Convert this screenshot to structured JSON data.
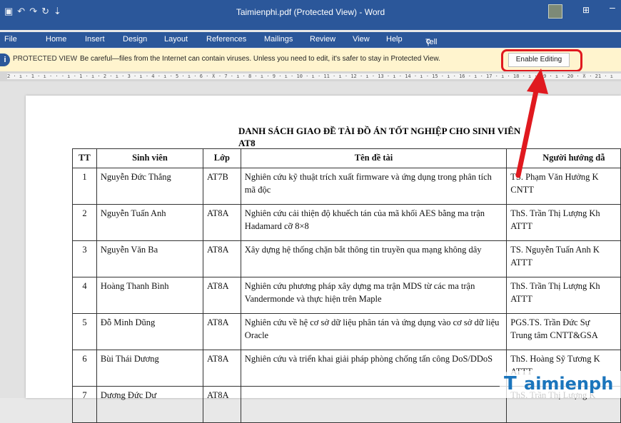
{
  "window": {
    "title": "Taimienphi.pdf (Protected View) - Word",
    "quick_access_icons": [
      "save-icon",
      "undo-icon",
      "redo-icon",
      "repeat-icon",
      "customize-icon"
    ],
    "ribbon_display_icon": "ribbon-display-options-icon",
    "minimize_glyph": "–"
  },
  "tabs": [
    "File",
    "Home",
    "Insert",
    "Design",
    "Layout",
    "References",
    "Mailings",
    "Review",
    "View",
    "Help"
  ],
  "tell_me": "Tell me what you want to do",
  "protected_view": {
    "label": "PROTECTED VIEW",
    "message": "Be careful—files from the Internet can contain viruses. Unless you need to edit, it's safer to stay in Protected View.",
    "button": "Enable Editing"
  },
  "ruler": {
    "text": "2 · ı · 1 · ı · · · ı · 1 · ı · 2 · ı · 3 · ı · 4 · ı · 5 · ı · 6 · ⊼ · 7 · ı · 8 · ı · 9 · ı · 10 · ı · 11 · ı · 12 · ı · 13 · ı · 14 · ı · 15 · ı · 16 · ı · 17 · ı · 18 · ı · 19 · ı · 20 · ⊼ · 21 · ı"
  },
  "document": {
    "title": "DANH SÁCH GIAO ĐỀ TÀI ĐỒ ÁN TỐT NGHIỆP CHO SINH VIÊN",
    "subtitle": "AT8",
    "table": {
      "headers": [
        "TT",
        "Sinh viên",
        "Lớp",
        "Tên đề tài",
        "Người hướng dẫ"
      ],
      "rows": [
        {
          "tt": "1",
          "name": "Nguyễn Đức Thắng",
          "class": "AT7B",
          "topic": "Nghiên cứu kỹ thuật trích xuất firmware và ứng dụng trong phân tích mã độc",
          "advisor_1": "TS. Phạm Văn Hưởng K",
          "advisor_2": "CNTT"
        },
        {
          "tt": "2",
          "name": "Nguyễn Tuấn Anh",
          "class": "AT8A",
          "topic": "Nghiên cứu cải thiện độ khuếch tán của mã khối AES bằng ma trận Hadamard cỡ 8×8",
          "advisor_1": "ThS. Trần Thị Lượng Kh",
          "advisor_2": "ATTT"
        },
        {
          "tt": "3",
          "name": "Nguyễn Văn Ba",
          "class": "AT8A",
          "topic": "Xây dựng hệ thống chặn bắt thông tin truyền qua mạng không dây",
          "advisor_1": "TS. Nguyễn Tuấn Anh K",
          "advisor_2": "ATTT"
        },
        {
          "tt": "4",
          "name": "Hoàng Thanh Bình",
          "class": "AT8A",
          "topic": "Nghiên cứu phương pháp xây dựng ma trận MDS từ các ma trận Vandermonde và thực hiện trên Maple",
          "advisor_1": "ThS. Trần Thị Lượng Kh",
          "advisor_2": "ATTT"
        },
        {
          "tt": "5",
          "name": "Đỗ Minh Dũng",
          "class": "AT8A",
          "topic": "Nghiên cứu về hệ cơ sở dữ liệu phân tán và ứng dụng vào cơ sở dữ liệu Oracle",
          "advisor_1": "PGS.TS. Trần Đức Sự",
          "advisor_2": "Trung tâm CNTT&GSA"
        },
        {
          "tt": "6",
          "name": "Bùi Thái Dương",
          "class": "AT8A",
          "topic": "Nghiên cứu và triển khai giải pháp phòng chống tấn công DoS/DDoS",
          "advisor_1": "ThS. Hoàng Sỹ Tương K",
          "advisor_2": "ATTT"
        }
      ],
      "partial_row": {
        "tt": "7",
        "name": "Dương Đức Dư",
        "class": "AT8A",
        "advisor_1": "ThS. Trần Thị Lượng K"
      }
    }
  },
  "watermark": {
    "logo": "T",
    "text": "aimienph"
  },
  "colors": {
    "word_blue": "#2b579a",
    "protected_bar": "#fff4ce",
    "highlight_red": "#e0191f",
    "watermark_blue": "#1b75bc"
  }
}
